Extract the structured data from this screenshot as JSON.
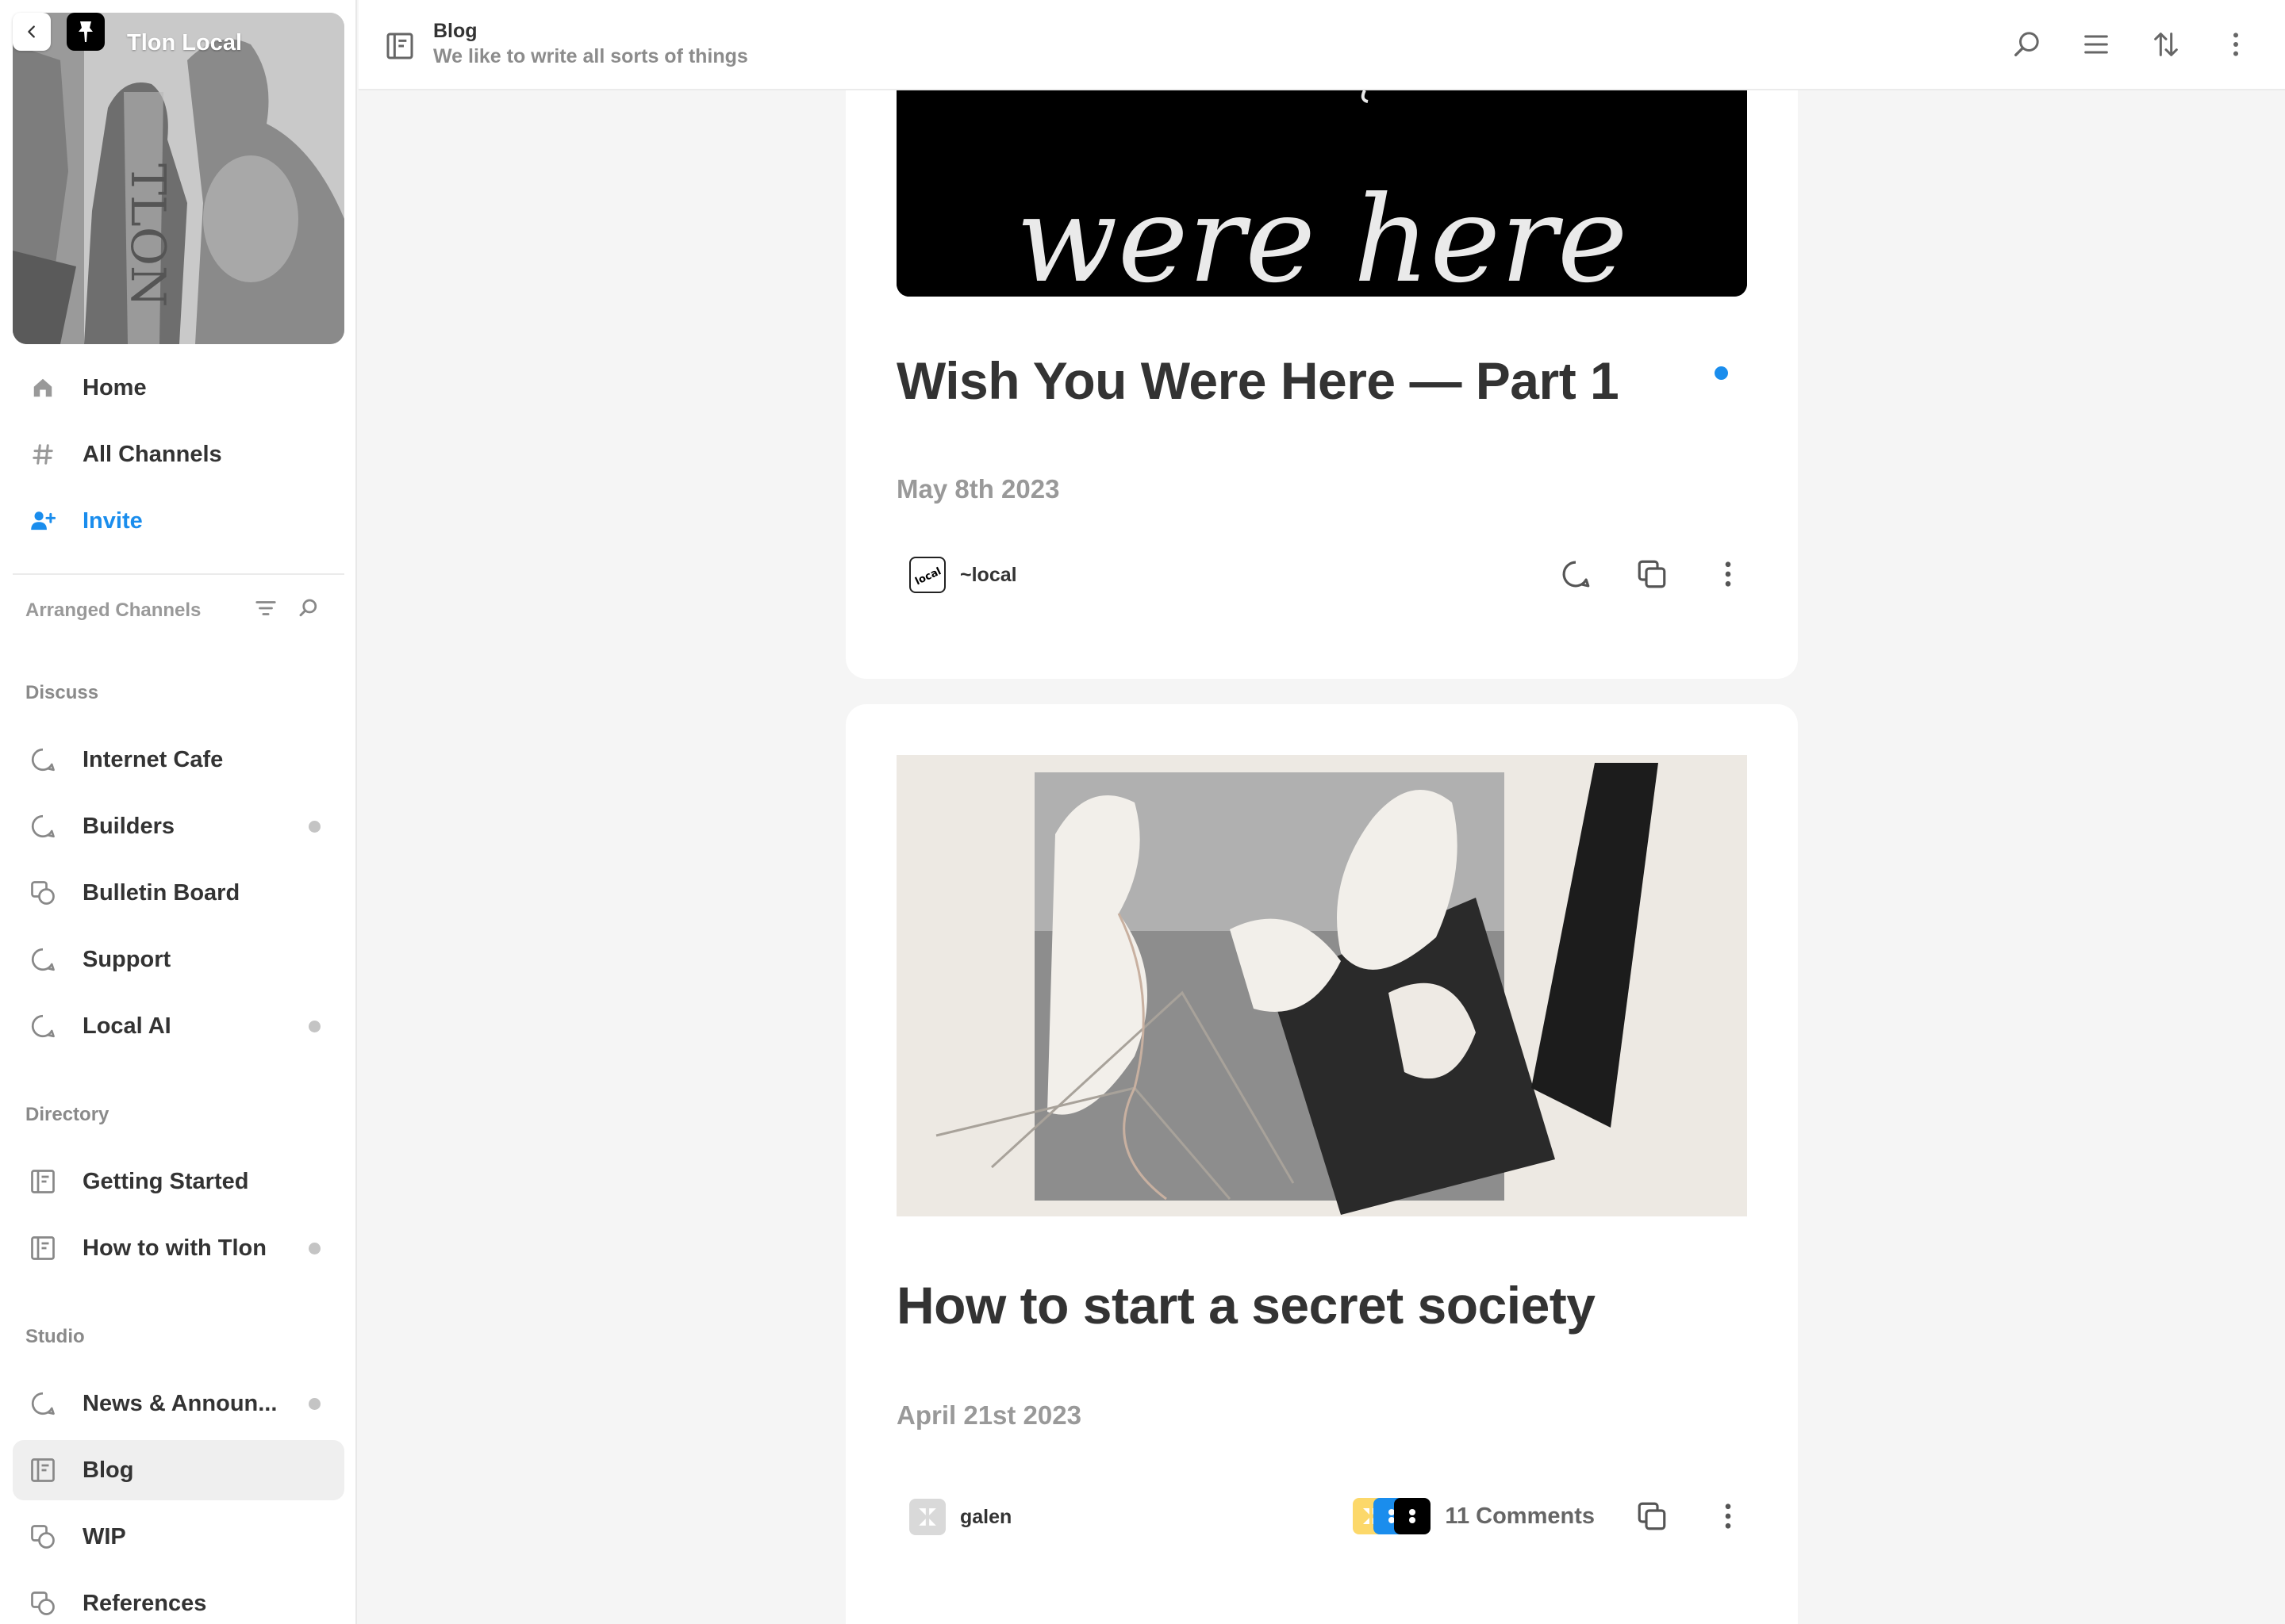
{
  "sidebar": {
    "group_name": "Tlon Local",
    "nav": [
      {
        "label": "Home",
        "icon": "home-icon"
      },
      {
        "label": "All Channels",
        "icon": "hash-icon"
      },
      {
        "label": "Invite",
        "icon": "add-person-icon"
      }
    ],
    "arranged_label": "Arranged Channels",
    "sections": [
      {
        "title": "Discuss",
        "channels": [
          {
            "label": "Internet Cafe",
            "icon": "chat-bubble-icon",
            "unread": false
          },
          {
            "label": "Builders",
            "icon": "chat-bubble-icon",
            "unread": true
          },
          {
            "label": "Bulletin Board",
            "icon": "gallery-icon",
            "unread": false
          },
          {
            "label": "Support",
            "icon": "chat-bubble-icon",
            "unread": false
          },
          {
            "label": "Local AI",
            "icon": "chat-bubble-icon",
            "unread": true
          }
        ]
      },
      {
        "title": "Directory",
        "channels": [
          {
            "label": "Getting Started",
            "icon": "notebook-icon",
            "unread": false
          },
          {
            "label": "How to with Tlon",
            "icon": "notebook-icon",
            "unread": true
          }
        ]
      },
      {
        "title": "Studio",
        "channels": [
          {
            "label": "News & Announ...",
            "icon": "chat-bubble-icon",
            "unread": true
          },
          {
            "label": "Blog",
            "icon": "notebook-icon",
            "unread": false,
            "active": true
          },
          {
            "label": "WIP",
            "icon": "gallery-icon",
            "unread": false
          },
          {
            "label": "References",
            "icon": "gallery-icon",
            "unread": false
          }
        ]
      }
    ]
  },
  "topbar": {
    "title": "Blog",
    "subtitle": "We like to write all sorts of things"
  },
  "posts": [
    {
      "image_text": "were here",
      "title": "Wish You Were Here — Part 1",
      "date": "May 8th 2023",
      "author": "~local",
      "unread": true
    },
    {
      "title": "How to start a secret society",
      "date": "April 21st 2023",
      "author": "galen",
      "comments": "11 Comments"
    }
  ],
  "colors": {
    "accent": "#1a8ded",
    "unread_dot": "#c4c4c4",
    "text": "#333333",
    "muted": "#999999"
  }
}
